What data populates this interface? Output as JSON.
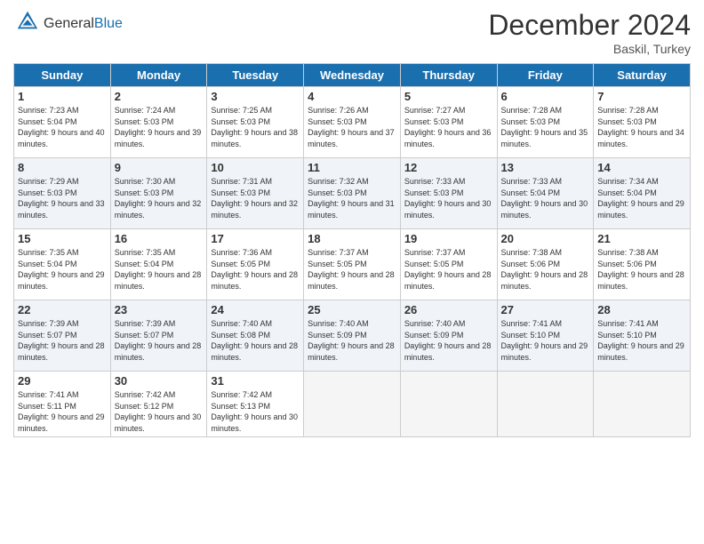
{
  "header": {
    "logo_general": "General",
    "logo_blue": "Blue",
    "month_year": "December 2024",
    "location": "Baskil, Turkey"
  },
  "days_of_week": [
    "Sunday",
    "Monday",
    "Tuesday",
    "Wednesday",
    "Thursday",
    "Friday",
    "Saturday"
  ],
  "weeks": [
    [
      {
        "day": "1",
        "sunrise": "7:23 AM",
        "sunset": "5:04 PM",
        "daylight": "9 hours and 40 minutes."
      },
      {
        "day": "2",
        "sunrise": "7:24 AM",
        "sunset": "5:03 PM",
        "daylight": "9 hours and 39 minutes."
      },
      {
        "day": "3",
        "sunrise": "7:25 AM",
        "sunset": "5:03 PM",
        "daylight": "9 hours and 38 minutes."
      },
      {
        "day": "4",
        "sunrise": "7:26 AM",
        "sunset": "5:03 PM",
        "daylight": "9 hours and 37 minutes."
      },
      {
        "day": "5",
        "sunrise": "7:27 AM",
        "sunset": "5:03 PM",
        "daylight": "9 hours and 36 minutes."
      },
      {
        "day": "6",
        "sunrise": "7:28 AM",
        "sunset": "5:03 PM",
        "daylight": "9 hours and 35 minutes."
      },
      {
        "day": "7",
        "sunrise": "7:28 AM",
        "sunset": "5:03 PM",
        "daylight": "9 hours and 34 minutes."
      }
    ],
    [
      {
        "day": "8",
        "sunrise": "7:29 AM",
        "sunset": "5:03 PM",
        "daylight": "9 hours and 33 minutes."
      },
      {
        "day": "9",
        "sunrise": "7:30 AM",
        "sunset": "5:03 PM",
        "daylight": "9 hours and 32 minutes."
      },
      {
        "day": "10",
        "sunrise": "7:31 AM",
        "sunset": "5:03 PM",
        "daylight": "9 hours and 32 minutes."
      },
      {
        "day": "11",
        "sunrise": "7:32 AM",
        "sunset": "5:03 PM",
        "daylight": "9 hours and 31 minutes."
      },
      {
        "day": "12",
        "sunrise": "7:33 AM",
        "sunset": "5:03 PM",
        "daylight": "9 hours and 30 minutes."
      },
      {
        "day": "13",
        "sunrise": "7:33 AM",
        "sunset": "5:04 PM",
        "daylight": "9 hours and 30 minutes."
      },
      {
        "day": "14",
        "sunrise": "7:34 AM",
        "sunset": "5:04 PM",
        "daylight": "9 hours and 29 minutes."
      }
    ],
    [
      {
        "day": "15",
        "sunrise": "7:35 AM",
        "sunset": "5:04 PM",
        "daylight": "9 hours and 29 minutes."
      },
      {
        "day": "16",
        "sunrise": "7:35 AM",
        "sunset": "5:04 PM",
        "daylight": "9 hours and 28 minutes."
      },
      {
        "day": "17",
        "sunrise": "7:36 AM",
        "sunset": "5:05 PM",
        "daylight": "9 hours and 28 minutes."
      },
      {
        "day": "18",
        "sunrise": "7:37 AM",
        "sunset": "5:05 PM",
        "daylight": "9 hours and 28 minutes."
      },
      {
        "day": "19",
        "sunrise": "7:37 AM",
        "sunset": "5:05 PM",
        "daylight": "9 hours and 28 minutes."
      },
      {
        "day": "20",
        "sunrise": "7:38 AM",
        "sunset": "5:06 PM",
        "daylight": "9 hours and 28 minutes."
      },
      {
        "day": "21",
        "sunrise": "7:38 AM",
        "sunset": "5:06 PM",
        "daylight": "9 hours and 28 minutes."
      }
    ],
    [
      {
        "day": "22",
        "sunrise": "7:39 AM",
        "sunset": "5:07 PM",
        "daylight": "9 hours and 28 minutes."
      },
      {
        "day": "23",
        "sunrise": "7:39 AM",
        "sunset": "5:07 PM",
        "daylight": "9 hours and 28 minutes."
      },
      {
        "day": "24",
        "sunrise": "7:40 AM",
        "sunset": "5:08 PM",
        "daylight": "9 hours and 28 minutes."
      },
      {
        "day": "25",
        "sunrise": "7:40 AM",
        "sunset": "5:09 PM",
        "daylight": "9 hours and 28 minutes."
      },
      {
        "day": "26",
        "sunrise": "7:40 AM",
        "sunset": "5:09 PM",
        "daylight": "9 hours and 28 minutes."
      },
      {
        "day": "27",
        "sunrise": "7:41 AM",
        "sunset": "5:10 PM",
        "daylight": "9 hours and 29 minutes."
      },
      {
        "day": "28",
        "sunrise": "7:41 AM",
        "sunset": "5:10 PM",
        "daylight": "9 hours and 29 minutes."
      }
    ],
    [
      {
        "day": "29",
        "sunrise": "7:41 AM",
        "sunset": "5:11 PM",
        "daylight": "9 hours and 29 minutes."
      },
      {
        "day": "30",
        "sunrise": "7:42 AM",
        "sunset": "5:12 PM",
        "daylight": "9 hours and 30 minutes."
      },
      {
        "day": "31",
        "sunrise": "7:42 AM",
        "sunset": "5:13 PM",
        "daylight": "9 hours and 30 minutes."
      },
      null,
      null,
      null,
      null
    ]
  ]
}
